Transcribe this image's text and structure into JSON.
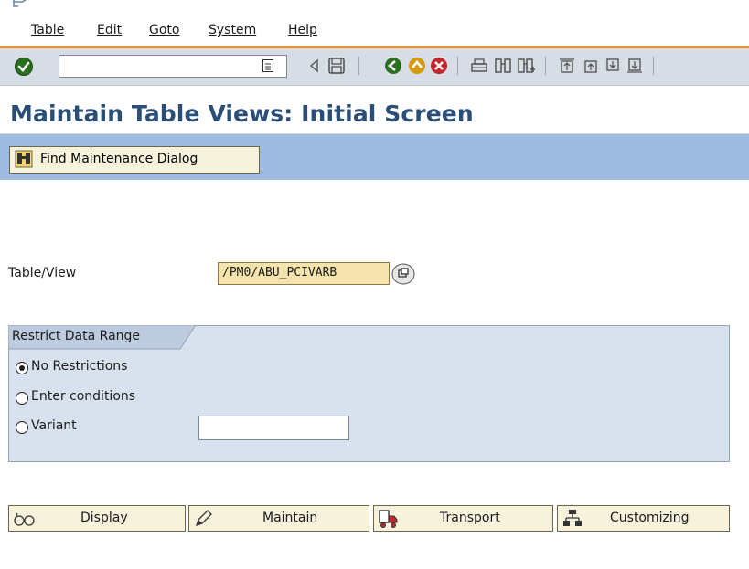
{
  "menu": {
    "items": [
      "Table",
      "Edit",
      "Goto",
      "System",
      "Help"
    ]
  },
  "toolbar": {
    "command_value": "",
    "icons": [
      "enter-icon",
      "back-arrow-icon",
      "save-icon",
      "back-icon",
      "exit-icon",
      "cancel-icon",
      "print-icon",
      "find-icon",
      "find-next-icon",
      "first-page-icon",
      "previous-page-icon",
      "next-page-icon",
      "last-page-icon"
    ]
  },
  "title": "Maintain Table Views: Initial Screen",
  "app_toolbar": {
    "find_label": "Find Maintenance Dialog"
  },
  "form": {
    "tableview_label": "Table/View",
    "tableview_value": "/PM0/ABU_PCIVARB",
    "group_title": "Restrict Data Range",
    "options": [
      {
        "label": "No Restrictions",
        "selected": true
      },
      {
        "label": "Enter conditions",
        "selected": false
      },
      {
        "label": "Variant",
        "selected": false
      }
    ],
    "variant_value": ""
  },
  "actions": [
    {
      "label": "Display",
      "icon": "glasses-icon"
    },
    {
      "label": "Maintain",
      "icon": "pencil-icon"
    },
    {
      "label": "Transport",
      "icon": "truck-icon"
    },
    {
      "label": "Customizing",
      "icon": "hierarchy-icon"
    }
  ],
  "colors": {
    "title": "#2b4e77",
    "accent_line": "#e58a2a",
    "app_toolbar": "#9fbbe0",
    "group_bg": "#d8e2ee",
    "field_required": "#f6e4ae"
  }
}
